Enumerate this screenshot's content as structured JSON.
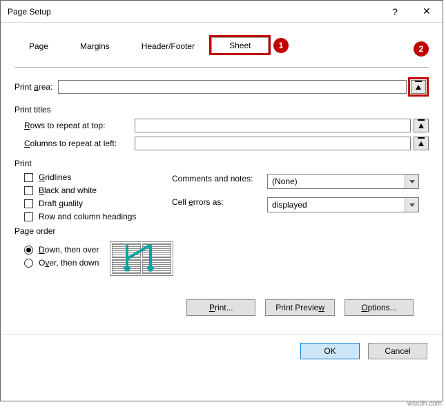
{
  "titlebar": {
    "title": "Page Setup"
  },
  "tabs": {
    "page": "Page",
    "margins": "Margins",
    "headerfooter": "Header/Footer",
    "sheet": "Sheet"
  },
  "callouts": {
    "one": "1",
    "two": "2"
  },
  "labels": {
    "print_area": "Print area:",
    "print_titles": "Print titles",
    "rows_repeat": "Rows to repeat at top:",
    "cols_repeat": "Columns to repeat at left:",
    "print": "Print",
    "gridlines": "Gridlines",
    "bw": "Black and white",
    "draft": "Draft quality",
    "rowcol": "Row and column headings",
    "comments": "Comments and notes:",
    "cellerrors": "Cell errors as:",
    "page_order": "Page order",
    "down_over": "Down, then over",
    "over_down": "Over, then down"
  },
  "values": {
    "print_area": "",
    "rows_repeat": "",
    "cols_repeat": "",
    "comments": "(None)",
    "cellerrors": "displayed"
  },
  "buttons": {
    "print": "Print...",
    "preview": "Print Preview",
    "options": "Options...",
    "ok": "OK",
    "cancel": "Cancel"
  },
  "watermark": "wsxdn.com"
}
